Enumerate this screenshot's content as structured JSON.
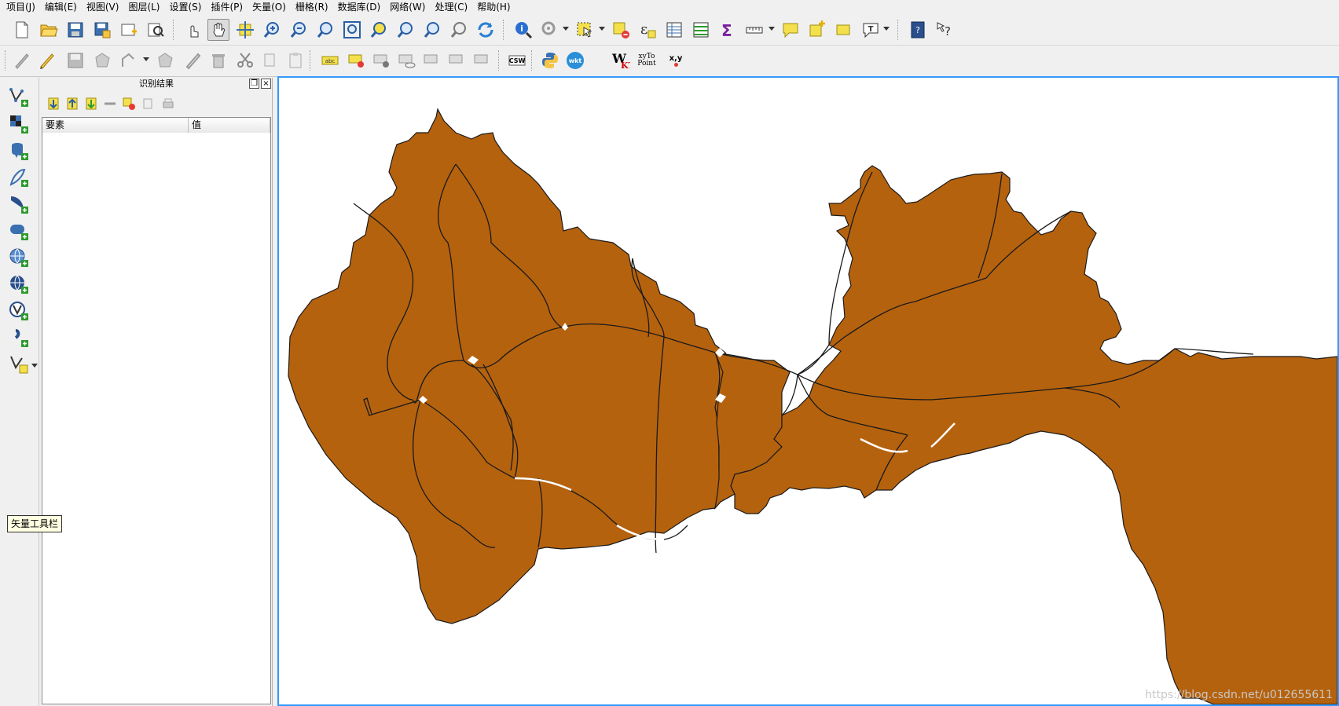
{
  "menu": {
    "items": [
      "项目(J)",
      "编辑(E)",
      "视图(V)",
      "图层(L)",
      "设置(S)",
      "插件(P)",
      "矢量(O)",
      "栅格(R)",
      "数据库(D)",
      "网络(W)",
      "处理(C)",
      "帮助(H)"
    ]
  },
  "toolbar2": {
    "csw_label": "CSW",
    "wkt_label": "wkt",
    "xyto_line1": "xyTo",
    "xyto_line2": "Point",
    "xy_label": "x,y"
  },
  "identify_panel": {
    "title": "识别结果",
    "columns": [
      "要素",
      "值"
    ]
  },
  "tooltip": {
    "text": "矢量工具栏"
  },
  "map": {
    "fill_color": "#b5620e",
    "stroke_color": "#1a1a1a",
    "watermark": "https://blog.csdn.net/u012655611"
  },
  "colors": {
    "selection_border": "#3399ff",
    "tooltip_bg": "#ffffe1"
  }
}
